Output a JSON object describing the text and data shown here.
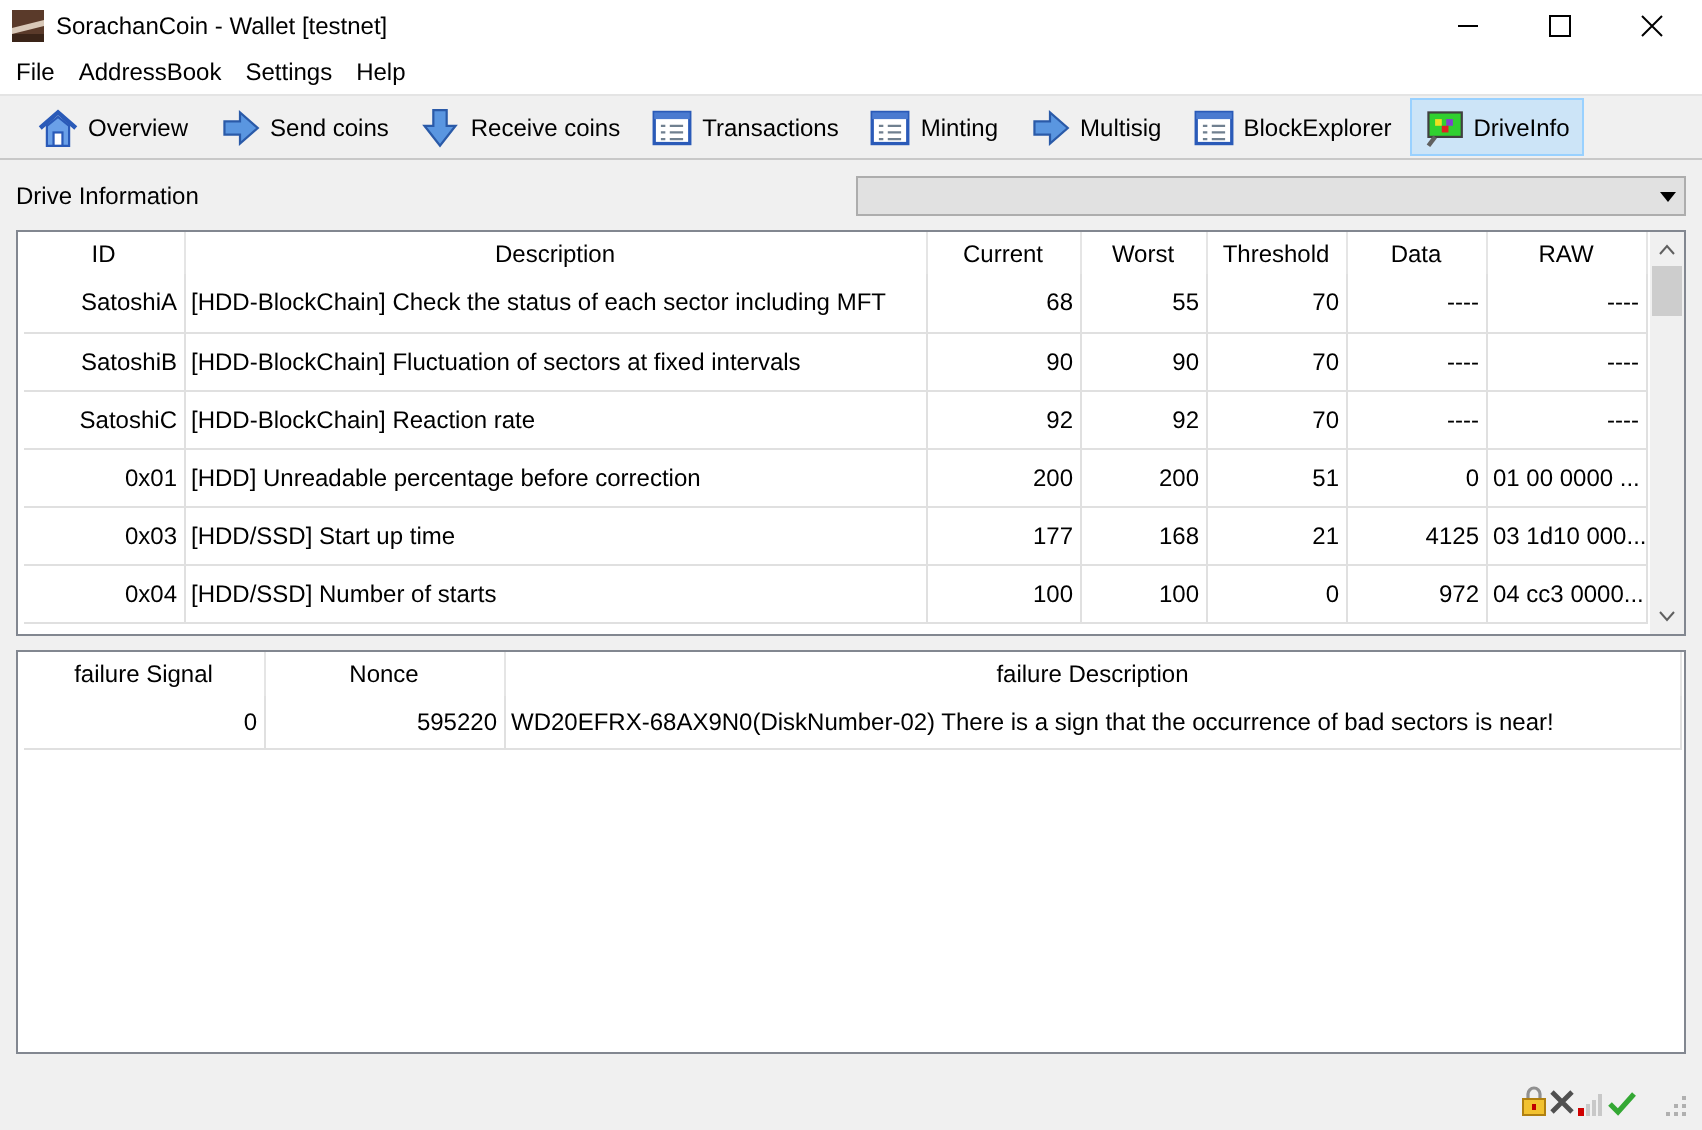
{
  "window": {
    "title": "SorachanCoin - Wallet [testnet]"
  },
  "menu": [
    "File",
    "AddressBook",
    "Settings",
    "Help"
  ],
  "toolbar": [
    {
      "label": "Overview",
      "kind": "house",
      "selected": false
    },
    {
      "label": "Send coins",
      "kind": "right",
      "selected": false
    },
    {
      "label": "Receive coins",
      "kind": "down",
      "selected": false
    },
    {
      "label": "Transactions",
      "kind": "list",
      "selected": false
    },
    {
      "label": "Minting",
      "kind": "list",
      "selected": false
    },
    {
      "label": "Multisig",
      "kind": "right",
      "selected": false
    },
    {
      "label": "BlockExplorer",
      "kind": "list",
      "selected": false
    },
    {
      "label": "DriveInfo",
      "kind": "monitor",
      "selected": true
    }
  ],
  "drive_label": "Drive Information",
  "smart_table": {
    "columns": [
      "ID",
      "Description",
      "Current",
      "Worst",
      "Threshold",
      "Data",
      "RAW"
    ],
    "rows": [
      [
        "SatoshiA",
        "[HDD-BlockChain] Check the status of each sector including MFT",
        "68",
        "55",
        "70",
        "----",
        "----"
      ],
      [
        "SatoshiB",
        "[HDD-BlockChain] Fluctuation of sectors at fixed intervals",
        "90",
        "90",
        "70",
        "----",
        "----"
      ],
      [
        "SatoshiC",
        "[HDD-BlockChain] Reaction rate",
        "92",
        "92",
        "70",
        "----",
        "----"
      ],
      [
        "0x01",
        "[HDD] Unreadable percentage before correction",
        "200",
        "200",
        "51",
        "0",
        "01 00 0000 ..."
      ],
      [
        "0x03",
        "[HDD/SSD] Start up time",
        "177",
        "168",
        "21",
        "4125",
        "03 1d10 000..."
      ],
      [
        "0x04",
        "[HDD/SSD] Number of starts",
        "100",
        "100",
        "0",
        "972",
        "04 cc3 0000..."
      ]
    ]
  },
  "failure_table": {
    "columns": [
      "failure Signal",
      "Nonce",
      "failure Description"
    ],
    "rows": [
      [
        "0",
        "595220",
        "WD20EFRX-68AX9N0(DiskNumber-02) There is a sign that the occurrence of bad sectors is near!"
      ]
    ]
  }
}
